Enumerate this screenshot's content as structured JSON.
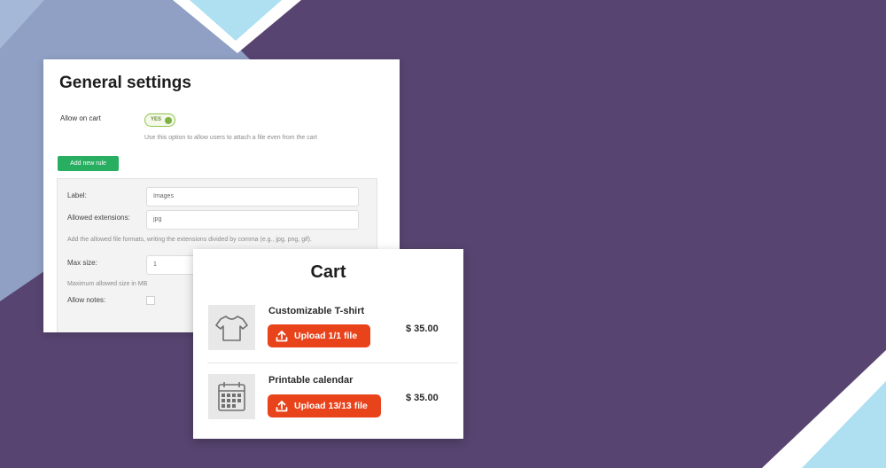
{
  "colors": {
    "background": "#574470",
    "accent_green": "#27ae60",
    "upload_orange": "#e8431b",
    "panel": "#ffffff"
  },
  "settings": {
    "title": "General settings",
    "allow_on_cart_label": "Allow on cart",
    "toggle_value": "YES",
    "allow_on_cart_help": "Use this option to allow users to attach a file even from the cart",
    "add_rule_label": "Add new rule",
    "rule": {
      "label_label": "Label:",
      "label_value": "Images",
      "extensions_label": "Allowed extensions:",
      "extensions_value": "jpg",
      "extensions_help": "Add the allowed file formats, writing the extensions divided by comma (e.g., jpg, png, gif).",
      "max_size_label": "Max size:",
      "max_size_value": "1",
      "max_size_help": "Maximum allowed size in MB",
      "allow_notes_label": "Allow notes:"
    }
  },
  "cart": {
    "title": "Cart",
    "items": [
      {
        "name": "Customizable T-shirt",
        "upload_label": "Upload 1/1 file",
        "price": "$ 35.00",
        "icon": "tshirt-icon"
      },
      {
        "name": "Printable calendar",
        "upload_label": "Upload 13/13 file",
        "price": "$ 35.00",
        "icon": "calendar-icon"
      }
    ]
  }
}
